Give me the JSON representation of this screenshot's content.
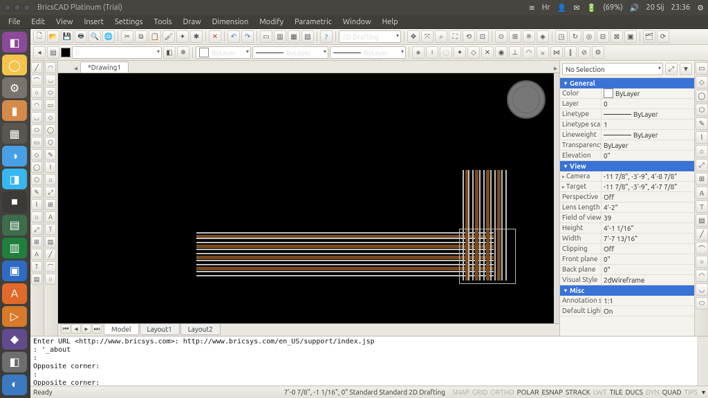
{
  "os": {
    "wifi_icon": "≋",
    "kb": "Hr",
    "mail": "✉",
    "battery": "(69%)",
    "vol": "🔊",
    "date": "20 Sij",
    "time": "23:36",
    "gear": "⚙"
  },
  "app": {
    "title": "BricsCAD Platinum (Trial)",
    "menu": [
      "File",
      "Edit",
      "View",
      "Insert",
      "Settings",
      "Tools",
      "Draw",
      "Dimension",
      "Modify",
      "Parametric",
      "Window",
      "Help"
    ],
    "workspace": "2D Drafting",
    "layer_index": "0",
    "color_swatch_name": "ByLayer",
    "linetype_name": "ByLayer",
    "lineweight_name": "ByLayer",
    "doc_tab": "*Drawing1",
    "model_tabs": [
      "Model",
      "Layout1",
      "Layout2"
    ]
  },
  "launcher": [
    "◧",
    "◯",
    "⚙",
    "▮",
    "▦",
    "◑",
    "◨",
    "■",
    "▤",
    "▥",
    "▣",
    "A",
    "▷",
    "◆",
    "◧",
    "◐"
  ],
  "cmd_lines": [
    "Enter URL <http://www.bricsys.com>: http://www.bricsys.com/en_US/support/index.jsp",
    ": '_about",
    ":",
    "Opposite corner:",
    ":",
    "Opposite corner:"
  ],
  "status": {
    "left": "Ready",
    "coords": "7'-0 7/8\", -1 1/16\", 0\"  Standard Standard 2D Drafting",
    "toggles": [
      "SNAP",
      "GRID",
      "ORTHO",
      "POLAR",
      "ESNAP",
      "STRACK",
      "LWT",
      "TILE",
      "DUCS",
      "DYN",
      "QUAD",
      "TIPS"
    ],
    "active": {
      "SNAP": false,
      "GRID": false,
      "ORTHO": false,
      "POLAR": true,
      "ESNAP": true,
      "STRACK": true,
      "LWT": false,
      "TILE": true,
      "DUCS": true,
      "DYN": false,
      "QUAD": true,
      "TIPS": false
    }
  },
  "props": {
    "selection": "No Selection",
    "sections": {
      "General": [
        {
          "k": "Color",
          "v": "ByLayer",
          "sw": true
        },
        {
          "k": "Layer",
          "v": "0"
        },
        {
          "k": "Linetype",
          "v": "ByLayer",
          "lt": true
        },
        {
          "k": "Linetype scale",
          "v": "1"
        },
        {
          "k": "Lineweight",
          "v": "ByLayer",
          "lt": true
        },
        {
          "k": "Transparency",
          "v": "ByLayer"
        },
        {
          "k": "Elevation",
          "v": "0\""
        }
      ],
      "View": [
        {
          "k": "Camera",
          "v": "-11 7/8\", -3'-9\", 4'-8 7/8\"",
          "sub": true
        },
        {
          "k": "Target",
          "v": "-11 7/8\", -3'-9\", 4'-7 7/8\"",
          "sub": true
        },
        {
          "k": "Perspective",
          "v": "Off"
        },
        {
          "k": "Lens Length",
          "v": "4'-2\""
        },
        {
          "k": "Field of view",
          "v": "39"
        },
        {
          "k": "Height",
          "v": "4'-1 1/16\""
        },
        {
          "k": "Width",
          "v": "7'-7 13/16\""
        },
        {
          "k": "Clipping",
          "v": "Off"
        },
        {
          "k": "Front plane",
          "v": "0\""
        },
        {
          "k": "Back plane",
          "v": "0\""
        },
        {
          "k": "Visual Style",
          "v": "2dWireframe"
        }
      ],
      "Misc": [
        {
          "k": "Annotation sca",
          "v": "1:1"
        },
        {
          "k": "Default Lightin",
          "v": "On"
        }
      ]
    }
  }
}
